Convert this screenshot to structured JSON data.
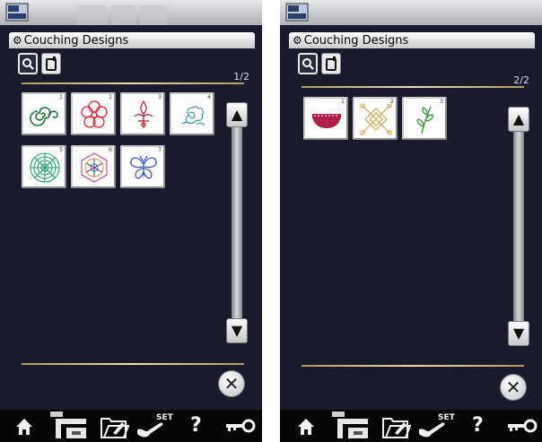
{
  "screens": [
    {
      "title": "Couching Designs",
      "page_indicator": "1/2",
      "designs": [
        {
          "number": "1",
          "icon": "spiral-design-icon"
        },
        {
          "number": "2",
          "icon": "flower-outline-design-icon"
        },
        {
          "number": "3",
          "icon": "fleur-de-lis-design-icon"
        },
        {
          "number": "4",
          "icon": "rose-design-icon"
        },
        {
          "number": "5",
          "icon": "circular-mandala-design-icon"
        },
        {
          "number": "6",
          "icon": "hexagon-flower-design-icon"
        },
        {
          "number": "7",
          "icon": "butterfly-design-icon"
        }
      ]
    },
    {
      "title": "Couching Designs",
      "page_indicator": "2/2",
      "designs": [
        {
          "number": "1",
          "icon": "scallop-border-design-icon"
        },
        {
          "number": "2",
          "icon": "lattice-square-design-icon"
        },
        {
          "number": "3",
          "icon": "vine-leaf-design-icon"
        }
      ]
    }
  ],
  "toolbar": {
    "set_label": "SET",
    "help_label": "?",
    "icons": [
      "home-icon",
      "sewing-machine-icon",
      "folder-icon",
      "wrench-icon",
      "help-icon",
      "key-icon"
    ]
  },
  "colors": {
    "screen_bg": "#191a2c",
    "accent_line": "#d9c58f",
    "bottom_bar": "#050505"
  }
}
